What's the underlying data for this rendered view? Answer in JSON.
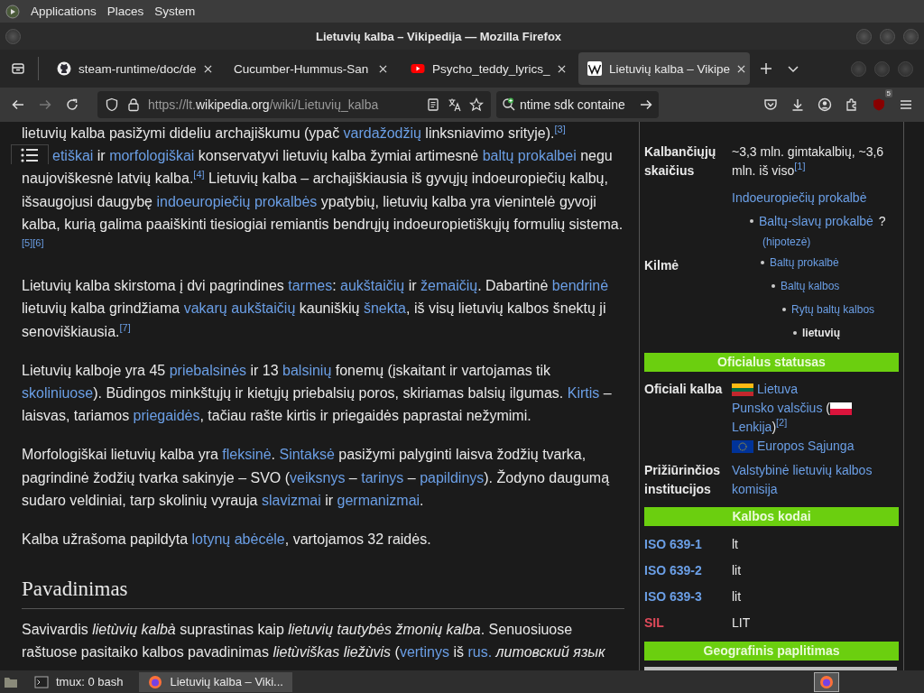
{
  "desktop_menu": [
    "Applications",
    "Places",
    "System"
  ],
  "window": {
    "title": "Lietuvių kalba – Vikipedija — Mozilla Firefox"
  },
  "tabs": [
    {
      "title": "steam-runtime/doc/de",
      "selected": false
    },
    {
      "title": "Cucumber-Hummus-San",
      "selected": false
    },
    {
      "title": "Psycho_teddy_lyrics_",
      "selected": false
    },
    {
      "title": "Lietuvių kalba – Vikipe",
      "selected": true
    }
  ],
  "address": {
    "scheme": "https://lt.",
    "host": "wikipedia.org",
    "path": "/wiki/Lietuvių_kalba"
  },
  "search": {
    "value": "ntime sdk containe"
  },
  "extension_badge": "5",
  "article": {
    "cut_line": [
      {
        "kind": "text",
        "text": "lietuvių kalba pasižymi dideliu archajiškumu (ypač "
      },
      {
        "kind": "link",
        "text": "vardažodžių"
      },
      {
        "kind": "text",
        "text": " linksniavimo srityje)."
      },
      {
        "kind": "ref",
        "text": "[3]"
      }
    ],
    "paragraphs": [
      [
        {
          "kind": "link",
          "text": "etiškai"
        },
        {
          "kind": "text",
          "text": " ir "
        },
        {
          "kind": "link",
          "text": "morfologiškai"
        },
        {
          "kind": "text",
          "text": " konservatyvi lietuvių kalba žymiai artimesnė "
        },
        {
          "kind": "link",
          "text": "baltų prokalbei"
        },
        {
          "kind": "text",
          "text": " negu naujoviškesnė latvių kalba."
        },
        {
          "kind": "ref",
          "text": "[4]"
        },
        {
          "kind": "text",
          "text": " Lietuvių kalba – archajiškiausia iš gyvųjų indoeuropiečių kalbų, išsaugojusi daugybę "
        },
        {
          "kind": "link",
          "text": "indoeuropiečių prokalbės"
        },
        {
          "kind": "text",
          "text": " ypatybių, lietuvių kalba yra vienintelė gyvoji kalba, kurią galima paaiškinti tiesiogiai remiantis bendrųjų indoeuropietiškųjų formulių sistema."
        },
        {
          "kind": "ref",
          "text": "[5]"
        },
        {
          "kind": "ref",
          "text": "[6]"
        }
      ],
      [
        {
          "kind": "text",
          "text": "Lietuvių kalba skirstoma į dvi pagrindines "
        },
        {
          "kind": "link",
          "text": "tarmes"
        },
        {
          "kind": "text",
          "text": ": "
        },
        {
          "kind": "link",
          "text": "aukštaičių"
        },
        {
          "kind": "text",
          "text": " ir "
        },
        {
          "kind": "link",
          "text": "žemaičių"
        },
        {
          "kind": "text",
          "text": ". Dabartinė "
        },
        {
          "kind": "link",
          "text": "bendrinė"
        },
        {
          "kind": "text",
          "text": " lietuvių kalba grindžiama "
        },
        {
          "kind": "link",
          "text": "vakarų aukštaičių"
        },
        {
          "kind": "text",
          "text": " kauniškių "
        },
        {
          "kind": "link",
          "text": "šnekta"
        },
        {
          "kind": "text",
          "text": ", iš visų lietuvių kalbos šnektų ji senoviškiausia."
        },
        {
          "kind": "ref",
          "text": "[7]"
        }
      ],
      [
        {
          "kind": "text",
          "text": "Lietuvių kalboje yra 45 "
        },
        {
          "kind": "link",
          "text": "priebalsinės"
        },
        {
          "kind": "text",
          "text": " ir 13 "
        },
        {
          "kind": "link",
          "text": "balsinių"
        },
        {
          "kind": "text",
          "text": " fonemų (įskaitant ir vartojamas tik "
        },
        {
          "kind": "link",
          "text": "skoliniuose"
        },
        {
          "kind": "text",
          "text": "). Būdingos minkštųjų ir kietųjų priebalsių poros, skiriamas balsių ilgumas. "
        },
        {
          "kind": "link",
          "text": "Kirtis"
        },
        {
          "kind": "text",
          "text": " – laisvas, tariamos "
        },
        {
          "kind": "link",
          "text": "priegaidės"
        },
        {
          "kind": "text",
          "text": ", tačiau rašte kirtis ir priegaidės paprastai nežymimi."
        }
      ],
      [
        {
          "kind": "text",
          "text": "Morfologiškai lietuvių kalba yra "
        },
        {
          "kind": "link",
          "text": "fleksinė"
        },
        {
          "kind": "text",
          "text": ". "
        },
        {
          "kind": "link",
          "text": "Sintaksė"
        },
        {
          "kind": "text",
          "text": " pasižymi palyginti laisva žodžių tvarka, pagrindinė žodžių tvarka sakinyje – SVO ("
        },
        {
          "kind": "link",
          "text": "veiksnys"
        },
        {
          "kind": "text",
          "text": " – "
        },
        {
          "kind": "link",
          "text": "tarinys"
        },
        {
          "kind": "text",
          "text": " – "
        },
        {
          "kind": "link",
          "text": "papildinys"
        },
        {
          "kind": "text",
          "text": "). Žodyno daugumą sudaro veldiniai, tarp skolinių vyrauja "
        },
        {
          "kind": "link",
          "text": "slavizmai"
        },
        {
          "kind": "text",
          "text": " ir "
        },
        {
          "kind": "link",
          "text": "germanizmai"
        },
        {
          "kind": "text",
          "text": "."
        }
      ],
      [
        {
          "kind": "text",
          "text": "Kalba užrašoma papildyta "
        },
        {
          "kind": "link",
          "text": "lotynų abėcėle"
        },
        {
          "kind": "text",
          "text": ", vartojamos 32 raidės."
        }
      ]
    ],
    "heading": "Pavadinimas",
    "after_heading": [
      {
        "kind": "text",
        "text": "Savivardis "
      },
      {
        "kind": "em",
        "text": "lietùvių kalbà"
      },
      {
        "kind": "text",
        "text": " suprastinas kaip "
      },
      {
        "kind": "em",
        "text": "lietuvių tautybės žmonių kalba"
      },
      {
        "kind": "text",
        "text": ". Senuosiuose raštuose pasitaiko kalbos pavadinimas "
      },
      {
        "kind": "em",
        "text": "lietùviškas liežùvis"
      },
      {
        "kind": "text",
        "text": " ("
      },
      {
        "kind": "link",
        "text": "vertinys"
      },
      {
        "kind": "text",
        "text": " iš "
      },
      {
        "kind": "link",
        "text": "rus."
      },
      {
        "kind": "em",
        "text": "литовский язык",
        "space_before": true
      }
    ]
  },
  "infobox": [
    {
      "kind": "row",
      "label": "Kalbančiųjų skaičius",
      "lines": [
        [
          {
            "kind": "text",
            "text": "~3,3 mln. gimtakalbių, ~3,6 mln. iš viso"
          },
          {
            "kind": "ref",
            "text": "[1]"
          }
        ]
      ]
    },
    {
      "kind": "tree",
      "label": "Kilmė",
      "tree": {
        "text": "Indoeuropiečių prokalbė",
        "link": true,
        "children": [
          {
            "text": "Baltų-slavų prokalbė",
            "link": true,
            "after": "?",
            "note": "(hipotezė)",
            "children": [
              {
                "text": "Baltų prokalbė",
                "link": true,
                "children": [
                  {
                    "text": "Baltų kalbos",
                    "link": true,
                    "children": [
                      {
                        "text": "Rytų baltų kalbos",
                        "link": true,
                        "children": [
                          {
                            "text": "lietuvių",
                            "link": false
                          }
                        ]
                      }
                    ]
                  }
                ]
              }
            ]
          }
        ]
      }
    },
    {
      "kind": "section",
      "label": "Oficialus statusas"
    },
    {
      "kind": "row",
      "label": "Oficiali kalba",
      "lines": [
        [
          {
            "kind": "lt_flag"
          },
          {
            "kind": "link",
            "text": "Lietuva"
          }
        ],
        [
          {
            "kind": "link",
            "text": "Punsko valsčius"
          },
          {
            "kind": "text",
            "text": " ("
          },
          {
            "kind": "pl_flag"
          },
          {
            "kind": "link",
            "text": "Lenkija"
          },
          {
            "kind": "text",
            "text": ")"
          },
          {
            "kind": "ref",
            "text": "[2]"
          }
        ],
        [
          {
            "kind": "eu_flag"
          },
          {
            "kind": "link",
            "text": "Europos Sąjunga"
          }
        ]
      ]
    },
    {
      "kind": "row",
      "label": "Prižiūrinčios institucijos",
      "lines": [
        [
          {
            "kind": "link",
            "text": "Valstybinė lietuvių kalbos komisija"
          }
        ]
      ]
    },
    {
      "kind": "section",
      "label": "Kalbos kodai"
    },
    {
      "kind": "code",
      "label": "ISO 639-1",
      "value": "lt",
      "missing": false
    },
    {
      "kind": "code",
      "label": "ISO 639-2",
      "value": "lit",
      "missing": false
    },
    {
      "kind": "code",
      "label": "ISO 639-3",
      "value": "lit",
      "missing": false
    },
    {
      "kind": "code",
      "label": "SIL",
      "value": "LIT",
      "missing": true
    },
    {
      "kind": "section",
      "label": "Geografinis paplitimas"
    },
    {
      "kind": "map"
    }
  ],
  "taskbar": [
    {
      "title": "tmux: 0 bash",
      "selected": false
    },
    {
      "title": "Lietuvių kalba – Viki...",
      "selected": true
    }
  ]
}
